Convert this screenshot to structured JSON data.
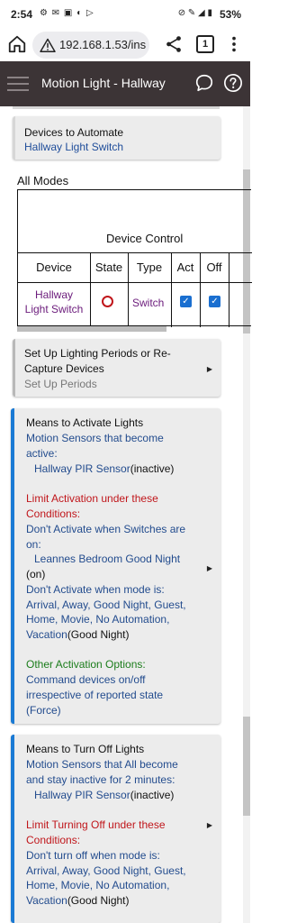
{
  "status_bar": {
    "time": "2:54",
    "left_icons": "⚙ ✉ ▣ ◐ ▷",
    "right_icons": "⊘ ✎ ◢ ▮",
    "battery": "53%"
  },
  "browser": {
    "url": "192.168.1.53/ins",
    "tab_count": "1"
  },
  "app_bar": {
    "title": "Motion Light - Hallway"
  },
  "devices_card": {
    "heading": "Devices to Automate",
    "value": "Hallway Light Switch"
  },
  "all_modes": {
    "label": "All Modes",
    "table": {
      "group_header": "Device Control",
      "columns": [
        "Device",
        "State",
        "Type",
        "Act",
        "Off"
      ],
      "rows": [
        {
          "device_line1": "Hallway",
          "device_line2": "Light Switch",
          "state": "off",
          "type": "Switch",
          "act_checked": true,
          "off_checked": true
        }
      ]
    }
  },
  "periods_card": {
    "line1": "Set Up Lighting Periods or Re-",
    "line2": "Capture Devices",
    "sub": "Set Up Periods"
  },
  "activate_card": {
    "heading": "Means to Activate Lights",
    "sensors_line1": "Motion Sensors that become",
    "sensors_line2": "active:",
    "sensor_name": "Hallway PIR Sensor",
    "sensor_state": "(inactive)",
    "limit_line1": "Limit Activation under these",
    "limit_line2": "Conditions:",
    "switch_line1": "Don't Activate when Switches are",
    "switch_line2": "on:",
    "switch_name": "Leannes Bedroom Good Night",
    "switch_state": "(on)",
    "mode_line1": "Don't Activate when mode is:",
    "mode_line2": "Arrival, Away, Good Night, Guest,",
    "mode_line3": "Home, Movie, No Automation,",
    "mode_line4": "Vacation",
    "mode_current": "(Good Night)",
    "other_heading": "Other Activation Options:",
    "other_line1": "Command devices on/off",
    "other_line2": "irrespective of reported state",
    "other_line3": "(Force)"
  },
  "turnoff_card": {
    "heading": "Means to Turn Off Lights",
    "sensors_line1": "Motion Sensors that All become",
    "sensors_line2": "and stay inactive for 2 minutes:",
    "sensor_name": "Hallway PIR Sensor",
    "sensor_state": "(inactive)",
    "limit_line1": "Limit Turning Off under these",
    "limit_line2": "Conditions:",
    "mode_line1": "Don't turn off when mode is:",
    "mode_line2": "Arrival, Away, Good Night, Guest,",
    "mode_line3": "Home, Movie, No Automation,",
    "mode_line4": "Vacation",
    "mode_current": "(Good Night)"
  },
  "arrow_glyph": "▶",
  "colors": {
    "app_bar_bg": "#3c3436",
    "accent_blue": "#1a7ad4",
    "link_blue": "#1f4d9a",
    "red": "#c0161b",
    "green": "#1b7d1b",
    "purple": "#6b1b7b",
    "checkbox": "#1a6fd0"
  }
}
